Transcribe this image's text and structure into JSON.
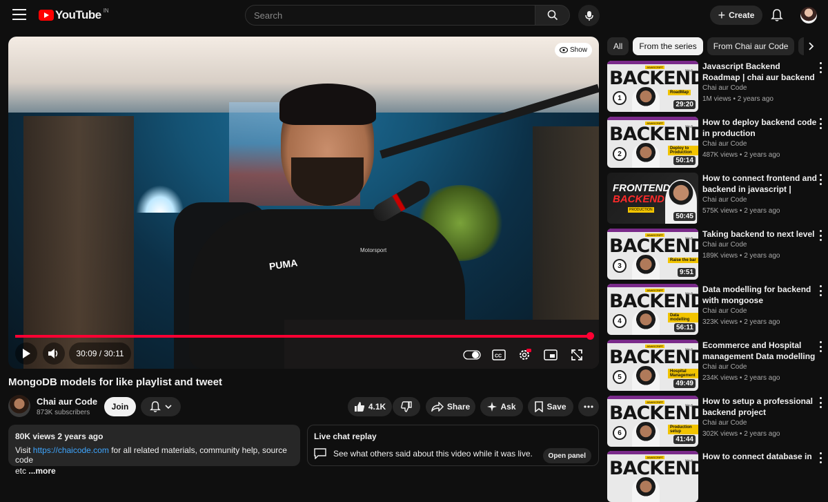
{
  "header": {
    "logo_text": "YouTube",
    "country": "IN",
    "search_placeholder": "Search",
    "create_label": "Create"
  },
  "player": {
    "show_label": "Show",
    "time_current": "30:09",
    "time_total": "30:11",
    "time_display": "30:09 / 30:11",
    "progress_fraction": 0.999,
    "progress_color": "#ff0033"
  },
  "video": {
    "title": "MongoDB models for like playlist and tweet",
    "channel_name": "Chai aur Code",
    "subscribers": "873K subscribers",
    "join_label": "Join",
    "likes": "4.1K",
    "share_label": "Share",
    "ask_label": "Ask",
    "save_label": "Save"
  },
  "description": {
    "meta": "80K views  2 years ago",
    "visit_prefix": "Visit ",
    "link": "https://chaicode.com",
    "visit_suffix": " for all related materials, community help, source code",
    "more_prefix": "etc",
    "more_label": "...more"
  },
  "chat": {
    "title": "Live chat replay",
    "subtitle": "See what others said about this video while it was live.",
    "open_label": "Open panel"
  },
  "chips": [
    "All",
    "From the series",
    "From Chai aur Code",
    "..."
  ],
  "recommendations": [
    {
      "title": "Javascript Backend Roadmap | chai aur backend",
      "channel": "Chai aur Code",
      "meta": "1M views • 2 years ago",
      "duration": "29:20",
      "num": "1",
      "tag": "RoadMap",
      "word": "BACKEND",
      "series": "JAVASCRIPT",
      "hindi": "Hindi"
    },
    {
      "title": "How to deploy backend code in production",
      "channel": "Chai aur Code",
      "meta": "487K views • 2 years ago",
      "duration": "50:14",
      "num": "2",
      "tag": "Deploy to Production",
      "word": "BACKEND",
      "series": "JAVASCRIPT",
      "hindi": "Hindi"
    },
    {
      "title": "How to connect frontend and backend in javascript | Fullstac...",
      "channel": "Chai aur Code",
      "meta": "575K views • 2 years ago",
      "duration": "50:45",
      "num": "",
      "tag": "PRODUCTION",
      "word": "FRONTEND",
      "word2": "BACKEND",
      "series": "",
      "hindi": "HINDI"
    },
    {
      "title": "Taking backend to next level",
      "channel": "Chai aur Code",
      "meta": "189K views • 2 years ago",
      "duration": "9:51",
      "num": "3",
      "tag": "Raise the bar",
      "word": "BACKEND",
      "series": "JAVASCRIPT",
      "hindi": "Hindi"
    },
    {
      "title": "Data modelling for backend with mongoose",
      "channel": "Chai aur Code",
      "meta": "323K views • 2 years ago",
      "duration": "56:11",
      "num": "4",
      "tag": "Data modelling",
      "word": "BACKEND",
      "series": "JAVASCRIPT",
      "hindi": "Hindi"
    },
    {
      "title": "Ecommerce and Hospital management Data modelling",
      "channel": "Chai aur Code",
      "meta": "234K views • 2 years ago",
      "duration": "49:49",
      "num": "5",
      "tag": "Hospital Management",
      "word": "BACKEND",
      "series": "JAVASCRIPT",
      "hindi": "Hindi"
    },
    {
      "title": "How to setup a professional backend project",
      "channel": "Chai aur Code",
      "meta": "302K views • 2 years ago",
      "duration": "41:44",
      "num": "6",
      "tag": "Production setup",
      "word": "BACKEND",
      "series": "JAVASCRIPT",
      "hindi": "Hindi"
    },
    {
      "title": "How to connect database in",
      "channel": "",
      "meta": "",
      "duration": "",
      "num": "",
      "tag": "",
      "word": "BACKEND",
      "series": "JAVASCRIPT",
      "hindi": "Hindi"
    }
  ],
  "scene_text": {
    "puma": "PUMA",
    "bmw": "Motorsport"
  }
}
